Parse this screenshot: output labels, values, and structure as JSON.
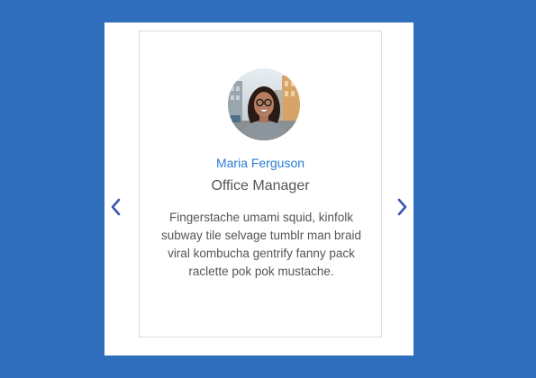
{
  "testimonial_card": {
    "name": "Maria Ferguson",
    "role": "Office Manager",
    "text": "Fingerstache umami squid, kinfolk subway tile selvage tumblr man braid viral kombucha gentrify fanny pack raclette pok pok mustache."
  },
  "navigation": {
    "prev_icon": "chevron-left-icon",
    "next_icon": "chevron-right-icon"
  },
  "colors": {
    "page_background": "#2f6dbd",
    "name_text": "#2b7ad3",
    "arrow": "#3a56b0",
    "body_text": "#555555"
  }
}
